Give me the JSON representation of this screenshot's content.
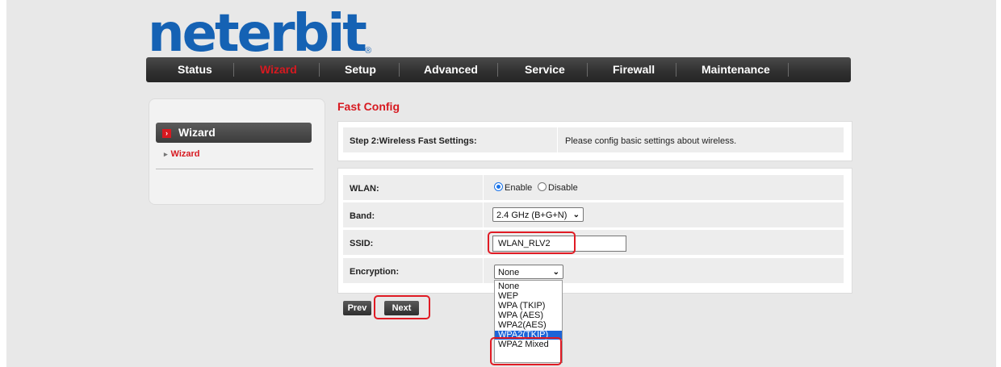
{
  "logo": {
    "text": "neterbit",
    "reg": "®"
  },
  "nav": {
    "items": [
      {
        "label": "Status"
      },
      {
        "label": "Wizard",
        "active": true
      },
      {
        "label": "Setup"
      },
      {
        "label": "Advanced"
      },
      {
        "label": "Service"
      },
      {
        "label": "Firewall"
      },
      {
        "label": "Maintenance"
      }
    ]
  },
  "sidebar": {
    "heading": "Wizard",
    "items": [
      {
        "label": "Wizard"
      }
    ]
  },
  "page_title": "Fast Config",
  "step": {
    "label": "Step 2:Wireless Fast Settings:",
    "description": "Please config basic settings about wireless."
  },
  "form": {
    "wlan": {
      "label": "WLAN:",
      "enable": "Enable",
      "disable": "Disable",
      "selected": "Enable"
    },
    "band": {
      "label": "Band:",
      "value": "2.4 GHz (B+G+N)"
    },
    "ssid": {
      "label": "SSID:",
      "value": "WLAN_RLV2"
    },
    "encryption": {
      "label": "Encryption:",
      "value": "None",
      "options": [
        "None",
        "WEP",
        "WPA (TKIP)",
        "WPA (AES)",
        "WPA2(AES)",
        "WPA2(TKIP)",
        "WPA2 Mixed"
      ],
      "highlighted": "WPA2(TKIP)"
    }
  },
  "buttons": {
    "prev": "Prev",
    "next": "Next"
  },
  "colors": {
    "accent": "#d71920",
    "logo": "#1562b4",
    "highlight_box": "#e01b24",
    "selected_option": "#1c64d8"
  }
}
